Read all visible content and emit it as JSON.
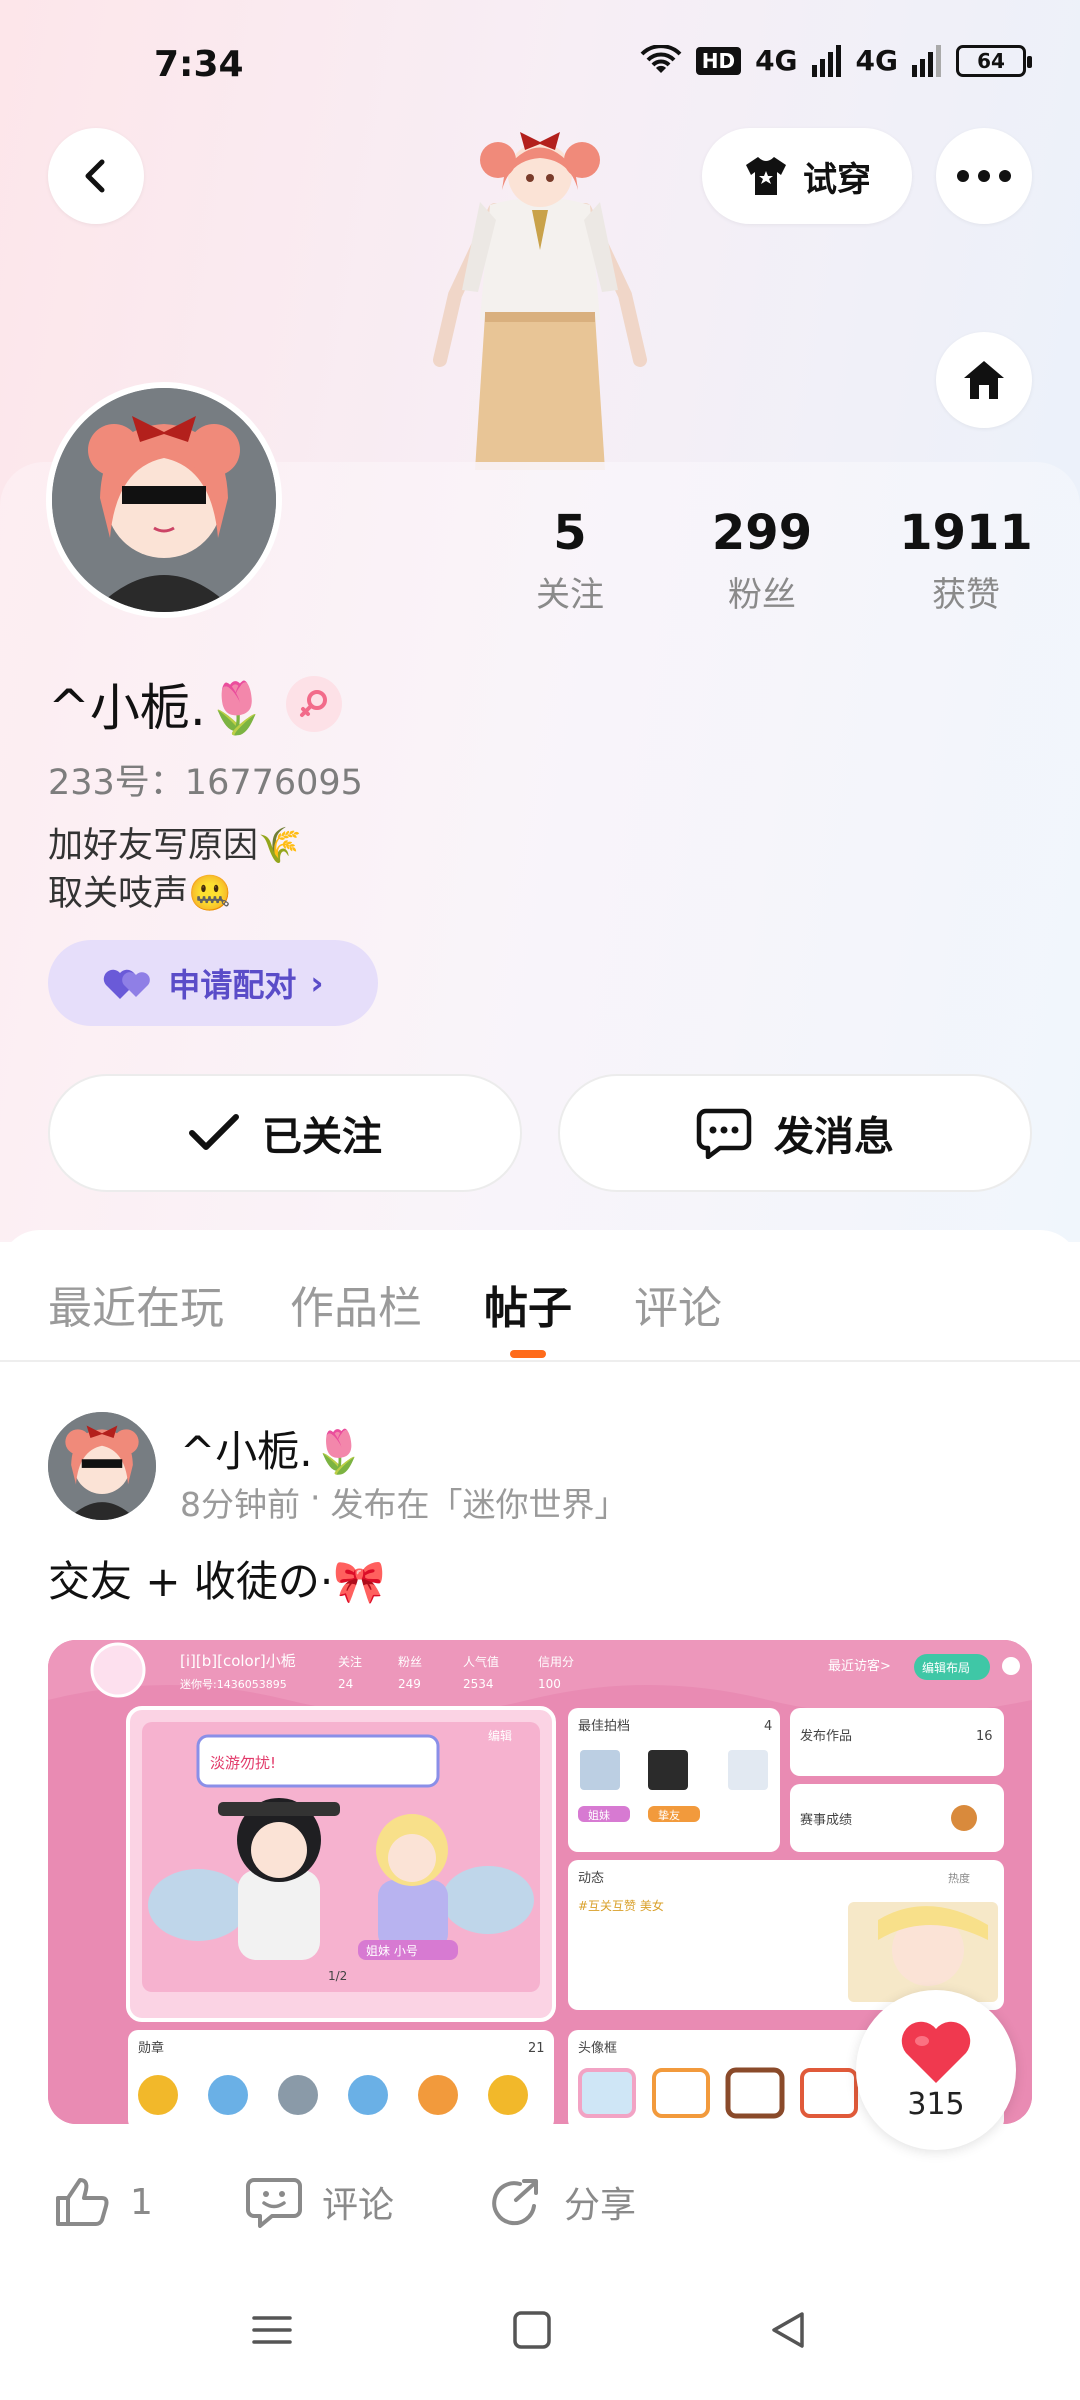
{
  "status_bar": {
    "time": "7:34",
    "network_hd": "HD",
    "network_1": "4G",
    "network_2": "4G",
    "battery": "64"
  },
  "header": {
    "tryon_label": "试穿",
    "back_icon": "chevron-left-icon",
    "more_icon": "more-dots-icon",
    "home_icon": "home-icon"
  },
  "profile": {
    "username": "^小栀.🌷",
    "uid": "233号：16776095",
    "bio_line1": "加好友写原因🌾",
    "bio_line2": "取关吱声🤐",
    "stats": [
      {
        "value": "5",
        "label": "关注"
      },
      {
        "value": "299",
        "label": "粉丝"
      },
      {
        "value": "1911",
        "label": "获赞"
      }
    ],
    "pair_label": "申请配对",
    "follow_label": "已关注",
    "message_label": "发消息"
  },
  "tabs": [
    {
      "label": "最近在玩",
      "active": false
    },
    {
      "label": "作品栏",
      "active": false
    },
    {
      "label": "帖子",
      "active": true
    },
    {
      "label": "评论",
      "active": false
    }
  ],
  "post": {
    "author": "^小栀.🌷",
    "time": "8分钟前",
    "separator": "·",
    "source": "发布在「迷你世界」",
    "text": "交友 + 收徒の·🎀",
    "likes": "1",
    "comment_label": "评论",
    "share_label": "分享",
    "floating_hearts": "315"
  },
  "screenshot_ui": {
    "name": "[i][b][color]小栀",
    "id_line": "迷你号:1436053895",
    "stat_labels": [
      "关注",
      "粉丝",
      "人气值",
      "信用分"
    ],
    "stat_values": [
      "24",
      "249",
      "2534",
      "100"
    ],
    "visitors": "最近访客>",
    "edit_layout": "编辑布局",
    "bubble_text": "淡游勿扰!",
    "edit": "编辑",
    "page_indicator": "1/2",
    "best_photo": "最佳拍档",
    "best_photo_count": "4",
    "publish": "发布作品",
    "publish_count": "16",
    "contest": "赛事成绩",
    "dynamic": "动态",
    "hot": "热度",
    "dynamic_tag": "#互关互赞 美女",
    "badge": "勋章",
    "badge_count": "21",
    "frame": "头像框",
    "sister_tag": "姐妹",
    "sister_tag2": "挚友",
    "character_tag": "姐妹 小号"
  },
  "colors": {
    "accent_orange": "#ff6b1a",
    "pair_purple": "#5a4cc8",
    "heart_red": "#f0394f"
  }
}
